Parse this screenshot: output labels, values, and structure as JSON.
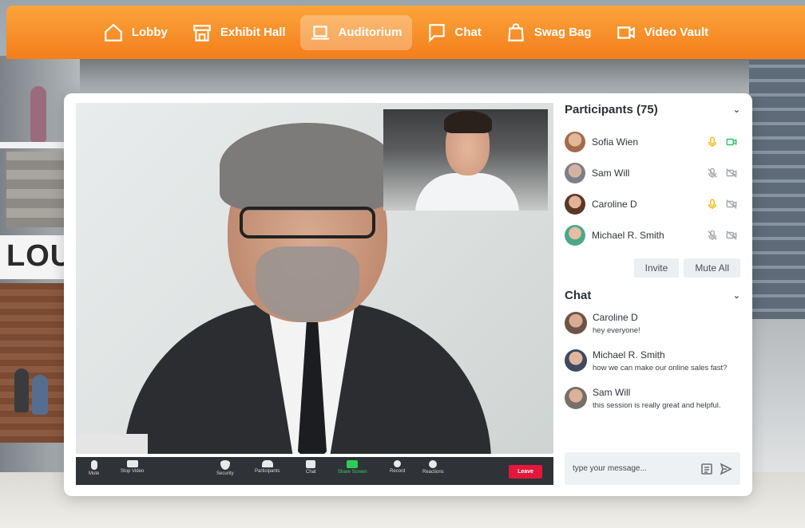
{
  "nav": {
    "items": [
      {
        "label": "Lobby",
        "icon": "home-icon"
      },
      {
        "label": "Exhibit Hall",
        "icon": "storefront-icon"
      },
      {
        "label": "Auditorium",
        "icon": "laptop-icon",
        "active": true
      },
      {
        "label": "Chat",
        "icon": "chat-bubble-icon"
      },
      {
        "label": "Swag Bag",
        "icon": "shopping-bag-icon"
      },
      {
        "label": "Video Vault",
        "icon": "video-camera-icon"
      }
    ],
    "accent": "#f7901e"
  },
  "scene": {
    "sign_text": "LOUN"
  },
  "participants": {
    "title": "Participants (75)",
    "list": [
      {
        "name": "Sofia Wien",
        "mic": "on",
        "video": "on",
        "avatar_color": "#a46a4c"
      },
      {
        "name": "Sam Will",
        "mic": "muted",
        "video": "off",
        "avatar_color": "#7c7f86"
      },
      {
        "name": "Caroline D",
        "mic": "on",
        "video": "off",
        "avatar_color": "#5b3727"
      },
      {
        "name": "Michael R. Smith",
        "mic": "muted",
        "video": "off",
        "avatar_color": "#4aa889"
      }
    ],
    "invite_label": "Invite",
    "mute_all_label": "Mute All"
  },
  "chat": {
    "title": "Chat",
    "messages": [
      {
        "name": "Caroline D",
        "text": "hey everyone!",
        "avatar_color": "#6d5447"
      },
      {
        "name": "Michael R. Smith",
        "text": "how we can make our online sales fast?",
        "avatar_color": "#3e4a5f"
      },
      {
        "name": "Sam Will",
        "text": "this session is really great and helpful.",
        "avatar_color": "#77706a"
      }
    ],
    "input_placeholder": "type your message..."
  },
  "controls": {
    "mute": "Mute",
    "stop_video": "Stop Video",
    "security": "Security",
    "participants": "Participants",
    "chat": "Chat",
    "share_screen": "Share Screen",
    "record": "Record",
    "reactions": "Reactions",
    "leave": "Leave"
  },
  "colors": {
    "mic_on": "#f2b705",
    "video_on": "#2cc36b",
    "muted_gray": "#a5a9af",
    "leave_red": "#e2183a",
    "share_green": "#2ecc55"
  }
}
